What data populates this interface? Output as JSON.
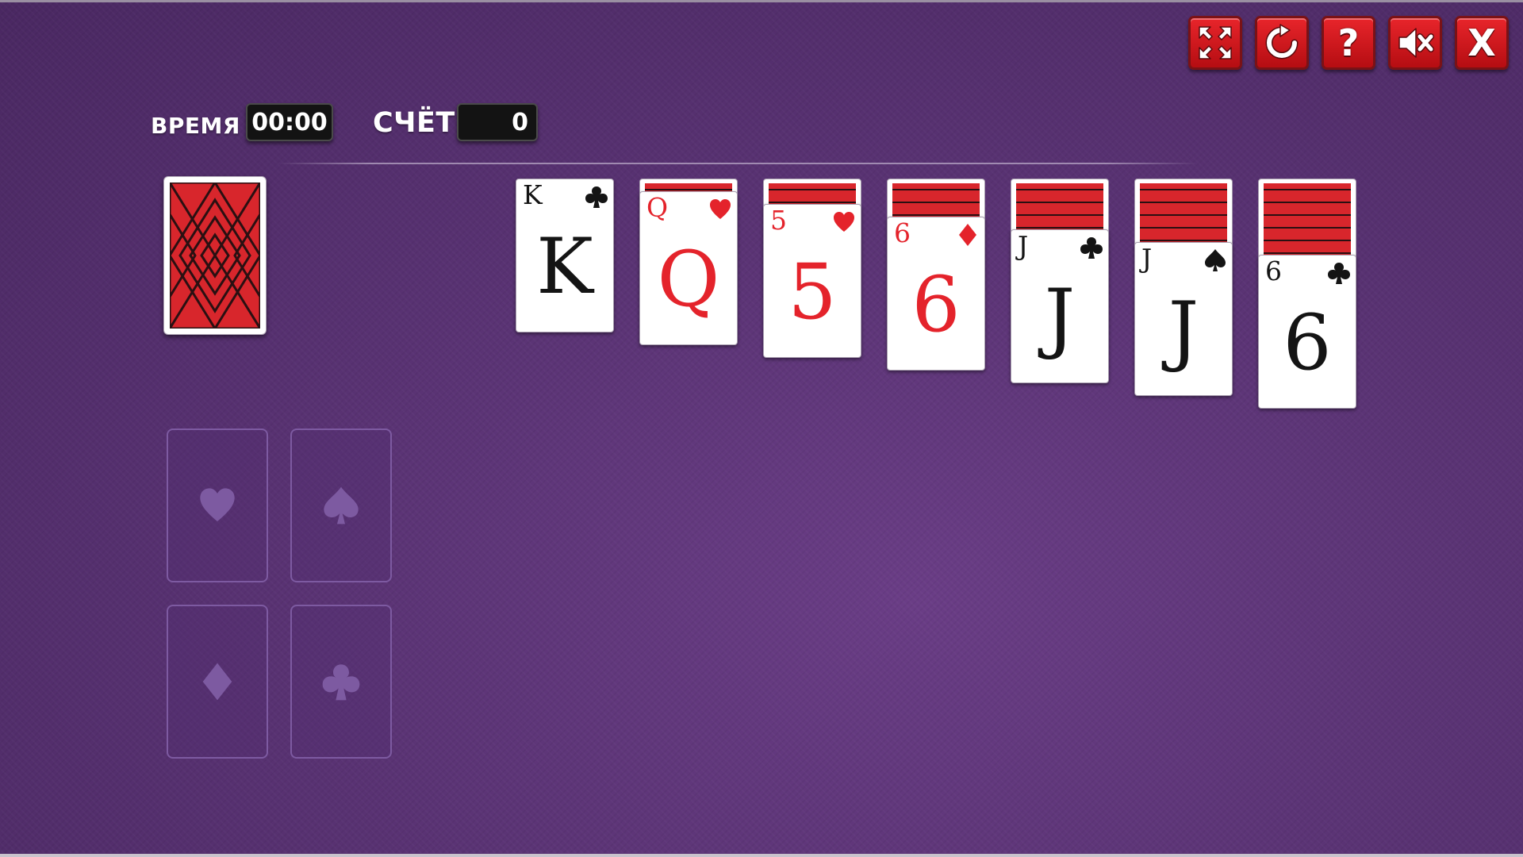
{
  "stats": {
    "time_label": "ВРЕМЯ",
    "time_value": "00:00",
    "score_label": "СЧЁТ",
    "score_value": "0"
  },
  "toolbar": {
    "help_label": "?",
    "close_label": "X"
  },
  "tableau": [
    {
      "hidden": 0,
      "rank": "K",
      "suit": "clubs",
      "color": "black"
    },
    {
      "hidden": 1,
      "rank": "Q",
      "suit": "hearts",
      "color": "red"
    },
    {
      "hidden": 2,
      "rank": "5",
      "suit": "hearts",
      "color": "red"
    },
    {
      "hidden": 3,
      "rank": "6",
      "suit": "diamonds",
      "color": "red"
    },
    {
      "hidden": 4,
      "rank": "J",
      "suit": "clubs",
      "color": "black"
    },
    {
      "hidden": 5,
      "rank": "J",
      "suit": "spades",
      "color": "black"
    },
    {
      "hidden": 6,
      "rank": "6",
      "suit": "clubs",
      "color": "black"
    }
  ],
  "foundations": [
    "hearts",
    "spades",
    "diamonds",
    "clubs"
  ],
  "colors": {
    "card_red": "#e4232b",
    "card_back_red": "#d8262c",
    "button_red": "#d9191f",
    "felt_purple": "#5a3374"
  }
}
